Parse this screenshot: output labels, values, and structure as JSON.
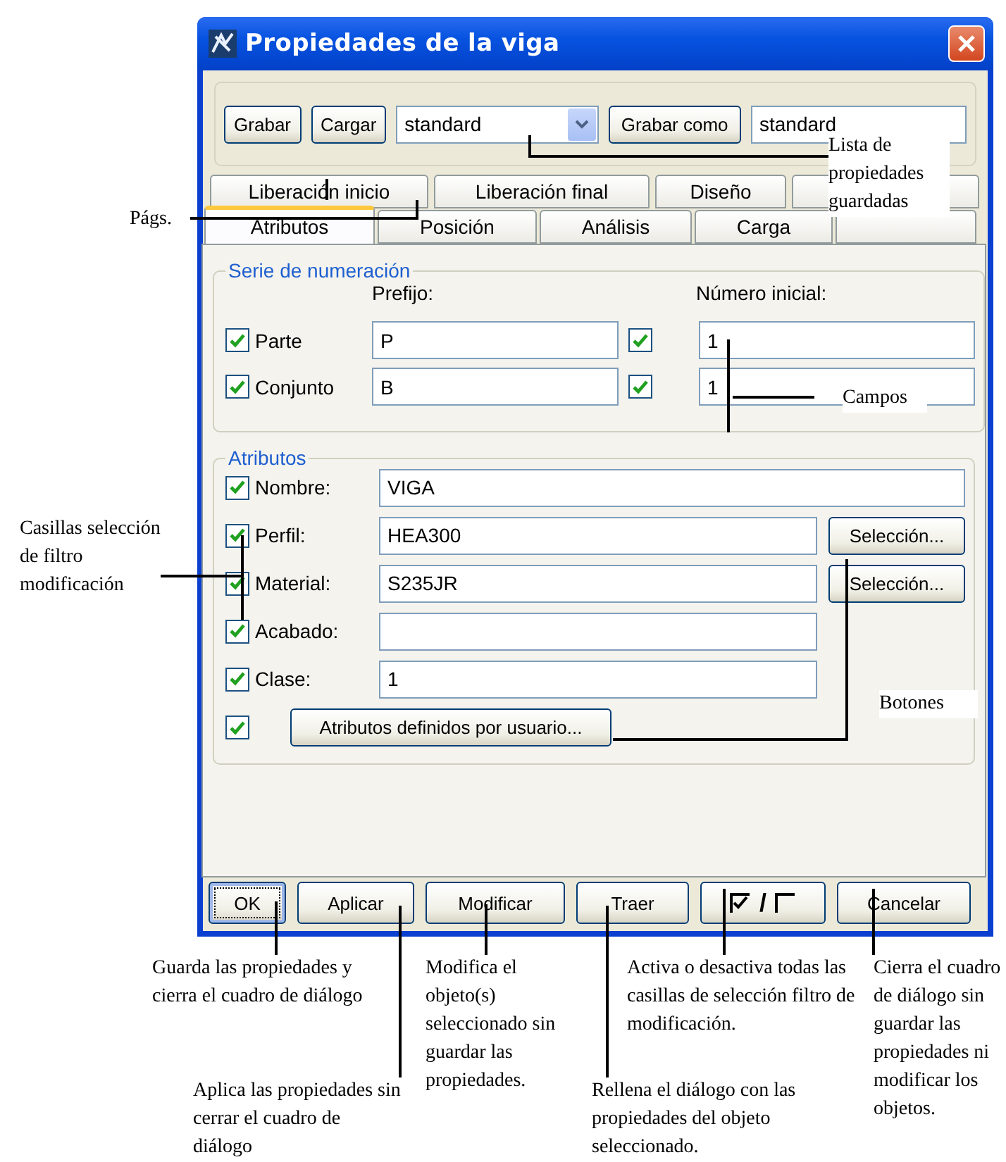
{
  "window": {
    "title": "Propiedades de la viga"
  },
  "toolbar": {
    "save_button": "Grabar",
    "load_button": "Cargar",
    "preset": "standard",
    "save_as_button": "Grabar como",
    "save_as_name": "standard"
  },
  "tabs_back": [
    {
      "label": "Liberación inicio",
      "selected": false
    },
    {
      "label": "Liberación final",
      "selected": false
    },
    {
      "label": "Diseño",
      "selected": false
    },
    {
      "selected": false
    }
  ],
  "tabs_front": [
    {
      "label": "Atributos",
      "selected": true
    },
    {
      "label": "Posición",
      "selected": false
    },
    {
      "label": "Análisis",
      "selected": false
    },
    {
      "label": "Carga",
      "selected": false
    },
    {
      "selected": false
    }
  ],
  "numbering": {
    "title": "Serie de numeración",
    "prefix_header": "Prefijo:",
    "start_header": "Número inicial:",
    "rows": [
      {
        "label": "Parte",
        "checked": true,
        "prefix": "P",
        "start_checked": true,
        "start": "1"
      },
      {
        "label": "Conjunto",
        "checked": true,
        "prefix": "B",
        "start_checked": true,
        "start": "1"
      }
    ]
  },
  "attributes": {
    "title": "Atributos",
    "rows": [
      {
        "label": "Nombre:",
        "checked": true,
        "value": "VIGA"
      },
      {
        "label": "Perfil:",
        "checked": true,
        "value": "HEA300",
        "button": "Selección..."
      },
      {
        "label": "Material:",
        "checked": true,
        "value": "S235JR",
        "button": "Selección..."
      },
      {
        "label": "Acabado:",
        "checked": true
      },
      {
        "label": "Clase:",
        "checked": true,
        "value": "1"
      }
    ],
    "user_defined": {
      "checked": true,
      "button": "Atributos definidos por usuario..."
    }
  },
  "buttons": [
    {
      "kind": "text",
      "label": "OK",
      "default": true
    },
    {
      "kind": "text",
      "label": "Aplicar",
      "default": false
    },
    {
      "kind": "text",
      "label": "Modificar",
      "default": false
    },
    {
      "kind": "text",
      "label": "Traer",
      "default": false
    },
    {
      "kind": "toggle",
      "label": "/",
      "default": false
    },
    {
      "kind": "text",
      "label": "Cancelar",
      "default": false
    }
  ],
  "annotations": [
    "Lista de propiedades guardadas",
    "Págs.",
    "Campos",
    "Casillas selección de filtro modificación",
    "Botones",
    "Guarda las propiedades y cierra el cuadro de diálogo",
    "Aplica las propiedades sin cerrar el cuadro de diálogo",
    "Modifica el objeto(s) seleccionado sin guardar las propiedades.",
    "Activa o desactiva todas las casillas de selección filtro de modificación.",
    "Rellena el diálogo con las propiedades del objeto seleccionado.",
    "Cierra el cuadro de diálogo sin guardar las propiedades ni modificar los objetos."
  ]
}
